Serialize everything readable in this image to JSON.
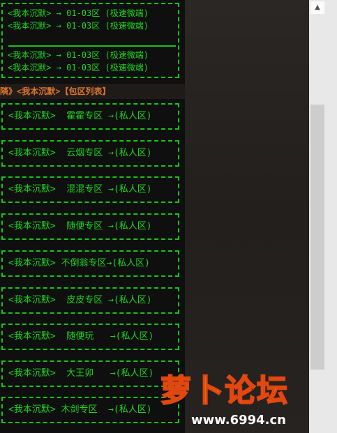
{
  "top_box": {
    "lines": [
      "<我本沉默> → 01-03区 (极速微端)",
      "<我本沉默> → 01-03区 (极速微端)",
      "<我本沉默> → 01-03区 (极速微端)",
      "<我本沉默> → 01-03区 (极速微端)"
    ]
  },
  "header": {
    "text": "隣》<我本沉默>【包区列表】"
  },
  "zones": [
    "<我本沉默>  霍霍专区 →(私人区)",
    "<我本沉默>  云烟专区 →(私人区)",
    "<我本沉默>  混混专区 →(私人区)",
    "<我本沉默>  随便专区 →(私人区)",
    "<我本沉默> 不倒翁专区→(私人区)",
    "<我本沉默>  皮皮专区 →(私人区)",
    "<我本沉默>  随便玩   →(私人区)",
    "<我本沉默>  大王卯   →(私人区)",
    "<我本沉默> 木剑专区  →(私人区)"
  ],
  "scrollbar": {
    "up_arrow_icon": "▲"
  },
  "watermark": {
    "title": "萝卜论坛",
    "url": "www.6994.cn"
  }
}
